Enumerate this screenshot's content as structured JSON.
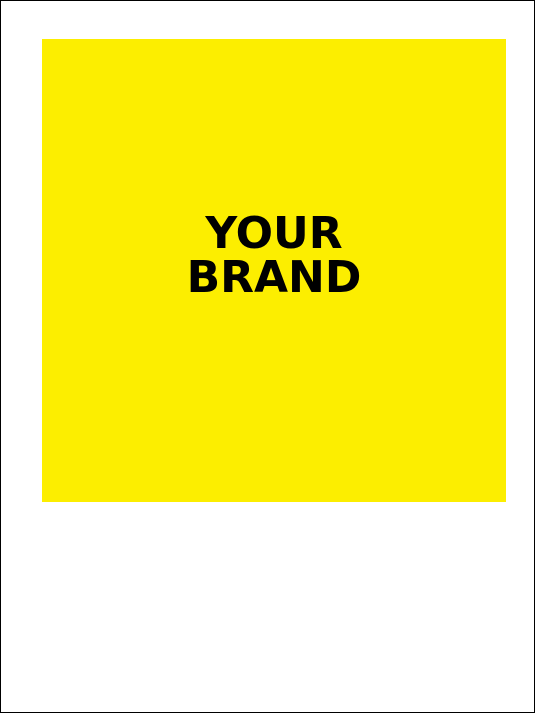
{
  "brand": {
    "line1": "YOUR",
    "line2": "BRAND",
    "background_color": "#fcee00",
    "text_color": "#000000"
  }
}
